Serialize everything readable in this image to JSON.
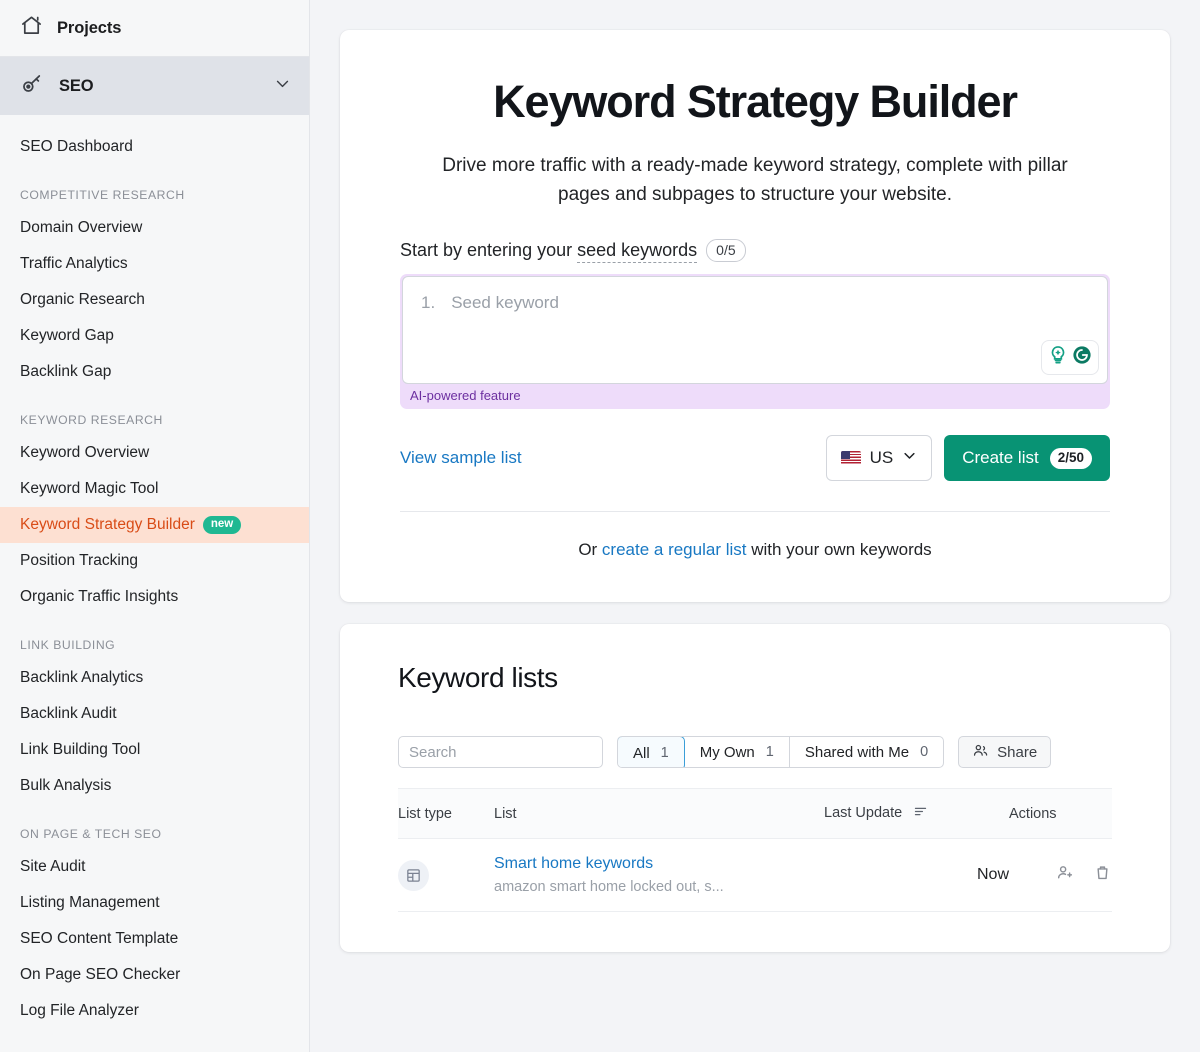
{
  "sidebar": {
    "projects_label": "Projects",
    "section_label": "SEO",
    "dashboard_label": "SEO Dashboard",
    "groups": [
      {
        "title": "COMPETITIVE RESEARCH",
        "items": [
          {
            "label": "Domain Overview"
          },
          {
            "label": "Traffic Analytics"
          },
          {
            "label": "Organic Research"
          },
          {
            "label": "Keyword Gap"
          },
          {
            "label": "Backlink Gap"
          }
        ]
      },
      {
        "title": "KEYWORD RESEARCH",
        "items": [
          {
            "label": "Keyword Overview"
          },
          {
            "label": "Keyword Magic Tool"
          },
          {
            "label": "Keyword Strategy Builder",
            "badge": "new",
            "active": true
          },
          {
            "label": "Position Tracking"
          },
          {
            "label": "Organic Traffic Insights"
          }
        ]
      },
      {
        "title": "LINK BUILDING",
        "items": [
          {
            "label": "Backlink Analytics"
          },
          {
            "label": "Backlink Audit"
          },
          {
            "label": "Link Building Tool"
          },
          {
            "label": "Bulk Analysis"
          }
        ]
      },
      {
        "title": "ON PAGE & TECH SEO",
        "items": [
          {
            "label": "Site Audit"
          },
          {
            "label": "Listing Management"
          },
          {
            "label": "SEO Content Template"
          },
          {
            "label": "On Page SEO Checker"
          },
          {
            "label": "Log File Analyzer"
          }
        ]
      }
    ]
  },
  "hero": {
    "title": "Keyword Strategy Builder",
    "subtitle": "Drive more traffic with a ready-made keyword strategy, complete with pillar pages and subpages to structure your website.",
    "seed_label_prefix": "Start by entering your ",
    "seed_label_link": "seed keywords",
    "seed_counter": "0/5",
    "seed_index": "1.",
    "seed_placeholder": "Seed keyword",
    "seed_value": "",
    "ai_banner_label": "AI-powered feature",
    "view_sample_label": "View sample list",
    "country_value": "US",
    "create_label": "Create list",
    "create_quota": "2/50",
    "or_prefix": "Or ",
    "or_link": "create a regular list",
    "or_suffix": " with your own keywords"
  },
  "lists": {
    "title": "Keyword lists",
    "search_placeholder": "Search",
    "search_value": "",
    "tabs": [
      {
        "label": "All",
        "count": "1",
        "active": true
      },
      {
        "label": "My Own",
        "count": "1",
        "active": false
      },
      {
        "label": "Shared with Me",
        "count": "0",
        "active": false
      }
    ],
    "share_label": "Share",
    "columns": {
      "type": "List type",
      "list": "List",
      "update": "Last Update",
      "actions": "Actions"
    },
    "rows": [
      {
        "name": "Smart home keywords",
        "preview": "amazon smart home locked out, s...",
        "updated": "Now"
      }
    ]
  },
  "colors": {
    "accent_green": "#089374",
    "link_blue": "#1878c3",
    "active_orange": "#d94c17",
    "active_bg": "#fde0d2",
    "badge_green": "#1fb892",
    "ai_purple": "#eedcfa",
    "tab_blue": "#3b9ed8"
  }
}
